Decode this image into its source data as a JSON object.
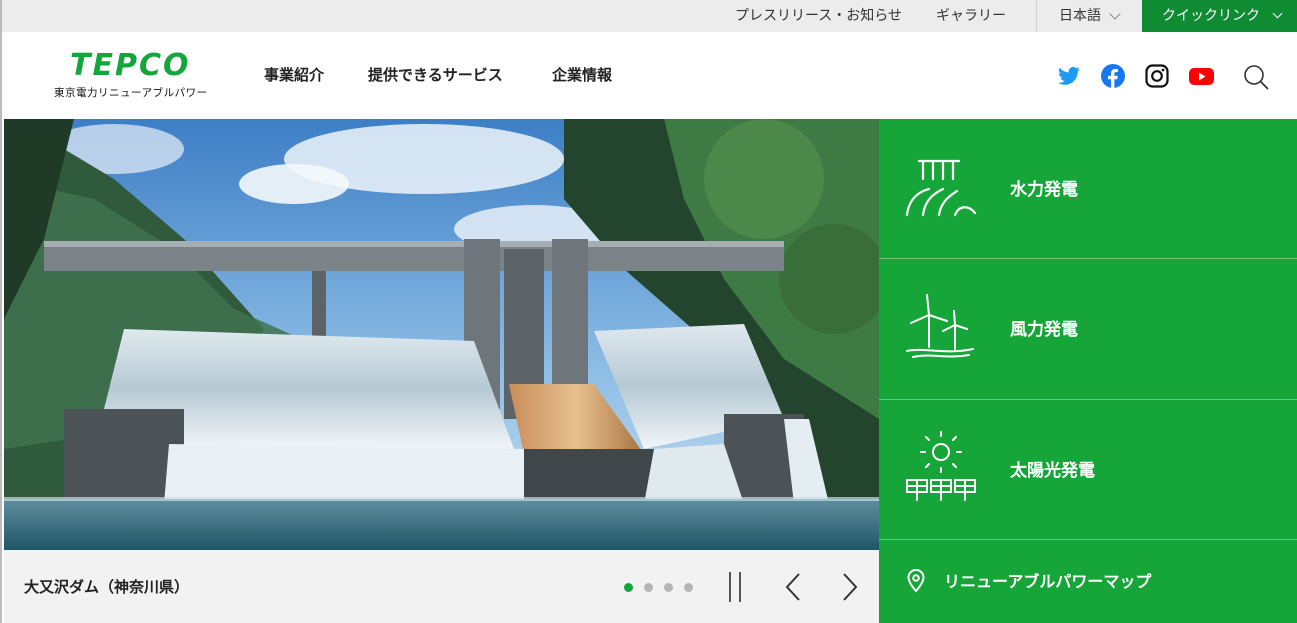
{
  "utility": {
    "press": "プレスリリース・お知らせ",
    "gallery": "ギャラリー",
    "language": "日本語",
    "quick_link": "クイックリンク"
  },
  "header": {
    "logo_mark": "TEPCO",
    "logo_sub": "東京電力リニューアブルパワー",
    "nav": [
      "事業紹介",
      "提供できるサービス",
      "企業情報"
    ],
    "social_icons": [
      "twitter-icon",
      "facebook-icon",
      "instagram-icon",
      "youtube-icon"
    ]
  },
  "hero": {
    "caption": "大又沢ダム（神奈川県）",
    "slide_count": 4,
    "active_slide": 1
  },
  "panel": {
    "items": [
      {
        "label": "水力発電",
        "icon": "hydro-icon"
      },
      {
        "label": "風力発電",
        "icon": "wind-icon"
      },
      {
        "label": "太陽光発電",
        "icon": "solar-icon"
      }
    ],
    "map_link": "リニューアブルパワーマップ"
  },
  "colors": {
    "brand_green": "#14a53b",
    "panel_green": "#16a538",
    "quick_green": "#0f8b33"
  }
}
